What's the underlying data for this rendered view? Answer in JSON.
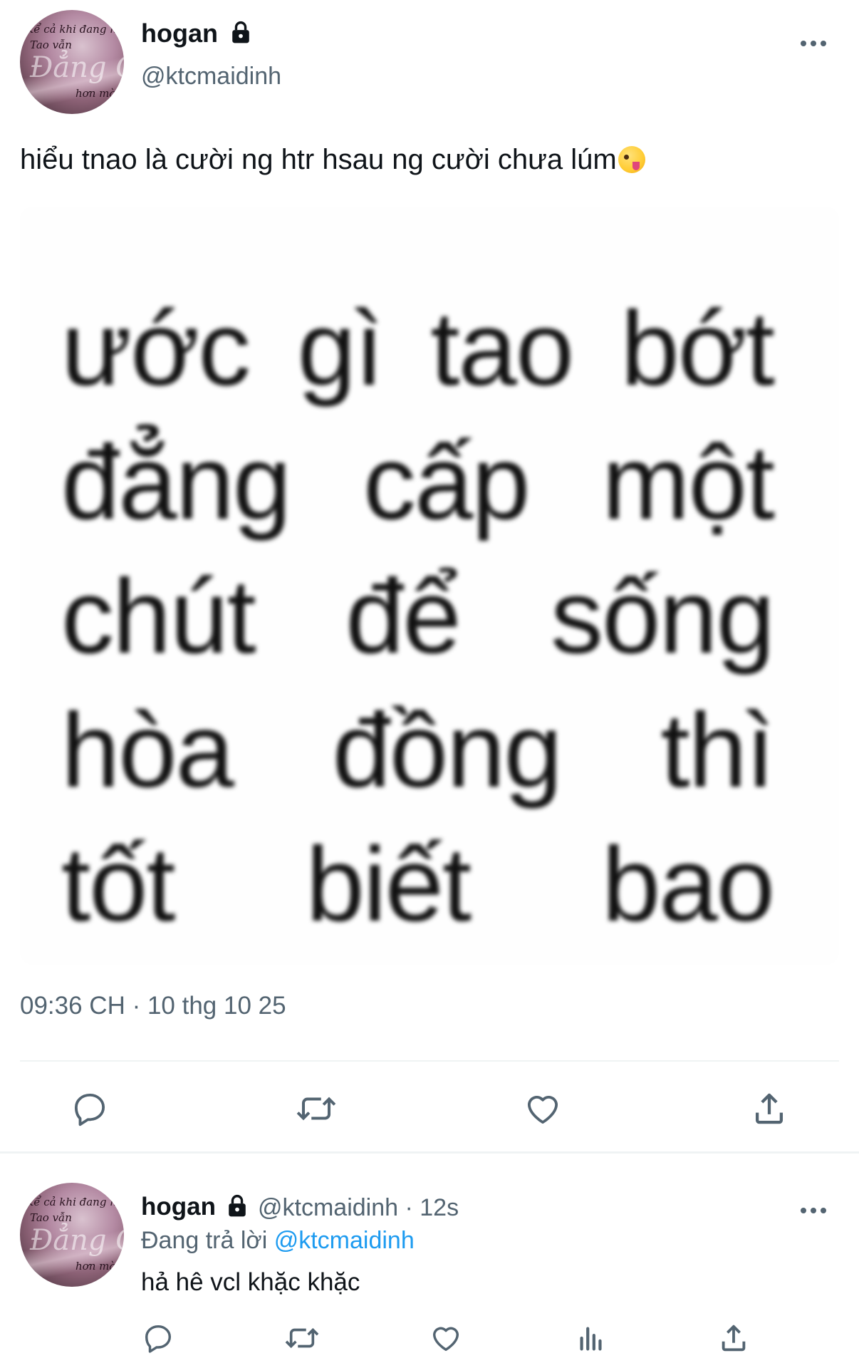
{
  "main_tweet": {
    "author": {
      "display_name": "hogan",
      "handle": "@ktcmaidinh",
      "avatar_text": [
        "Kể cả khi đang ngủ",
        "Tao vẫn",
        "Đẳng Cấp",
        "hơn mày"
      ]
    },
    "text": "hiểu tnao là cười ng htr hsau ng cười chưa lúm",
    "image_text_lines": [
      [
        "ước",
        "gì",
        "tao",
        "bớt"
      ],
      [
        "đẳng",
        "cấp",
        "một"
      ],
      [
        "chút",
        "để",
        "sống"
      ],
      [
        "hòa",
        "đồng",
        "thì"
      ],
      [
        "tốt",
        "biết",
        "bao"
      ]
    ],
    "timestamp": "09:36 CH · 10 thg 10 25",
    "actions": [
      "reply-icon",
      "retweet-icon",
      "like-icon",
      "share-icon"
    ]
  },
  "reply_tweet": {
    "author": {
      "display_name": "hogan",
      "handle": "@ktcmaidinh",
      "time": "· 12s"
    },
    "replying_prefix": "Đang trả lời",
    "replying_to": "@ktcmaidinh",
    "text": "hả hê vcl khặc khặc",
    "actions": [
      "reply-icon",
      "retweet-icon",
      "like-icon",
      "analytics-icon",
      "share-icon"
    ]
  },
  "colors": {
    "text": "#0f1419",
    "secondary": "#536471",
    "link": "#1d9bf0",
    "divider": "#eff3f4"
  }
}
